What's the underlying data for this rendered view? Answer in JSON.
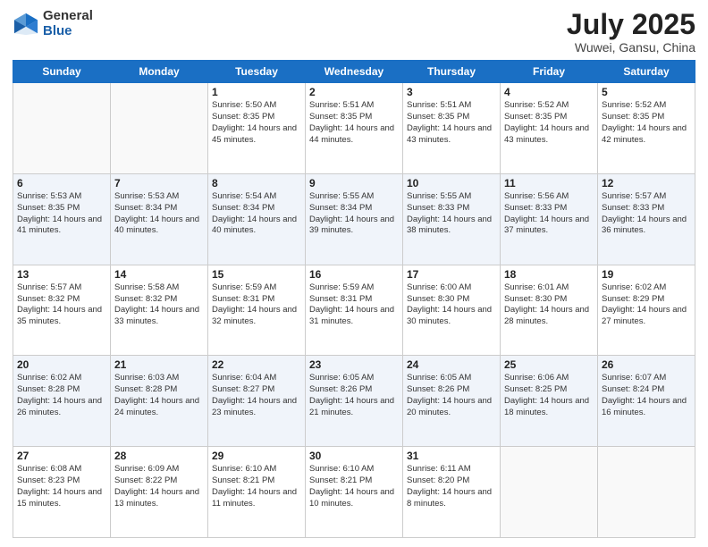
{
  "logo": {
    "general": "General",
    "blue": "Blue"
  },
  "title": "July 2025",
  "subtitle": "Wuwei, Gansu, China",
  "days_of_week": [
    "Sunday",
    "Monday",
    "Tuesday",
    "Wednesday",
    "Thursday",
    "Friday",
    "Saturday"
  ],
  "weeks": [
    [
      {
        "day": "",
        "info": ""
      },
      {
        "day": "",
        "info": ""
      },
      {
        "day": "1",
        "info": "Sunrise: 5:50 AM\nSunset: 8:35 PM\nDaylight: 14 hours and 45 minutes."
      },
      {
        "day": "2",
        "info": "Sunrise: 5:51 AM\nSunset: 8:35 PM\nDaylight: 14 hours and 44 minutes."
      },
      {
        "day": "3",
        "info": "Sunrise: 5:51 AM\nSunset: 8:35 PM\nDaylight: 14 hours and 43 minutes."
      },
      {
        "day": "4",
        "info": "Sunrise: 5:52 AM\nSunset: 8:35 PM\nDaylight: 14 hours and 43 minutes."
      },
      {
        "day": "5",
        "info": "Sunrise: 5:52 AM\nSunset: 8:35 PM\nDaylight: 14 hours and 42 minutes."
      }
    ],
    [
      {
        "day": "6",
        "info": "Sunrise: 5:53 AM\nSunset: 8:35 PM\nDaylight: 14 hours and 41 minutes."
      },
      {
        "day": "7",
        "info": "Sunrise: 5:53 AM\nSunset: 8:34 PM\nDaylight: 14 hours and 40 minutes."
      },
      {
        "day": "8",
        "info": "Sunrise: 5:54 AM\nSunset: 8:34 PM\nDaylight: 14 hours and 40 minutes."
      },
      {
        "day": "9",
        "info": "Sunrise: 5:55 AM\nSunset: 8:34 PM\nDaylight: 14 hours and 39 minutes."
      },
      {
        "day": "10",
        "info": "Sunrise: 5:55 AM\nSunset: 8:33 PM\nDaylight: 14 hours and 38 minutes."
      },
      {
        "day": "11",
        "info": "Sunrise: 5:56 AM\nSunset: 8:33 PM\nDaylight: 14 hours and 37 minutes."
      },
      {
        "day": "12",
        "info": "Sunrise: 5:57 AM\nSunset: 8:33 PM\nDaylight: 14 hours and 36 minutes."
      }
    ],
    [
      {
        "day": "13",
        "info": "Sunrise: 5:57 AM\nSunset: 8:32 PM\nDaylight: 14 hours and 35 minutes."
      },
      {
        "day": "14",
        "info": "Sunrise: 5:58 AM\nSunset: 8:32 PM\nDaylight: 14 hours and 33 minutes."
      },
      {
        "day": "15",
        "info": "Sunrise: 5:59 AM\nSunset: 8:31 PM\nDaylight: 14 hours and 32 minutes."
      },
      {
        "day": "16",
        "info": "Sunrise: 5:59 AM\nSunset: 8:31 PM\nDaylight: 14 hours and 31 minutes."
      },
      {
        "day": "17",
        "info": "Sunrise: 6:00 AM\nSunset: 8:30 PM\nDaylight: 14 hours and 30 minutes."
      },
      {
        "day": "18",
        "info": "Sunrise: 6:01 AM\nSunset: 8:30 PM\nDaylight: 14 hours and 28 minutes."
      },
      {
        "day": "19",
        "info": "Sunrise: 6:02 AM\nSunset: 8:29 PM\nDaylight: 14 hours and 27 minutes."
      }
    ],
    [
      {
        "day": "20",
        "info": "Sunrise: 6:02 AM\nSunset: 8:28 PM\nDaylight: 14 hours and 26 minutes."
      },
      {
        "day": "21",
        "info": "Sunrise: 6:03 AM\nSunset: 8:28 PM\nDaylight: 14 hours and 24 minutes."
      },
      {
        "day": "22",
        "info": "Sunrise: 6:04 AM\nSunset: 8:27 PM\nDaylight: 14 hours and 23 minutes."
      },
      {
        "day": "23",
        "info": "Sunrise: 6:05 AM\nSunset: 8:26 PM\nDaylight: 14 hours and 21 minutes."
      },
      {
        "day": "24",
        "info": "Sunrise: 6:05 AM\nSunset: 8:26 PM\nDaylight: 14 hours and 20 minutes."
      },
      {
        "day": "25",
        "info": "Sunrise: 6:06 AM\nSunset: 8:25 PM\nDaylight: 14 hours and 18 minutes."
      },
      {
        "day": "26",
        "info": "Sunrise: 6:07 AM\nSunset: 8:24 PM\nDaylight: 14 hours and 16 minutes."
      }
    ],
    [
      {
        "day": "27",
        "info": "Sunrise: 6:08 AM\nSunset: 8:23 PM\nDaylight: 14 hours and 15 minutes."
      },
      {
        "day": "28",
        "info": "Sunrise: 6:09 AM\nSunset: 8:22 PM\nDaylight: 14 hours and 13 minutes."
      },
      {
        "day": "29",
        "info": "Sunrise: 6:10 AM\nSunset: 8:21 PM\nDaylight: 14 hours and 11 minutes."
      },
      {
        "day": "30",
        "info": "Sunrise: 6:10 AM\nSunset: 8:21 PM\nDaylight: 14 hours and 10 minutes."
      },
      {
        "day": "31",
        "info": "Sunrise: 6:11 AM\nSunset: 8:20 PM\nDaylight: 14 hours and 8 minutes."
      },
      {
        "day": "",
        "info": ""
      },
      {
        "day": "",
        "info": ""
      }
    ]
  ]
}
